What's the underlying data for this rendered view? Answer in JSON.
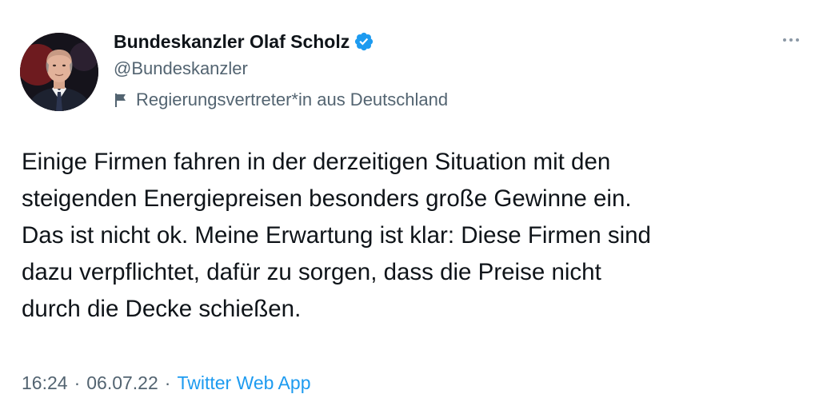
{
  "author": {
    "display_name": "Bundeskanzler Olaf Scholz",
    "handle": "@Bundeskanzler",
    "label": "Regierungsvertreter*in aus Deutschland",
    "verified": true,
    "avatar_icon": "avatar-photo"
  },
  "tweet": {
    "lines": [
      "Einige Firmen fahren in der derzeitigen Situation mit den",
      "steigenden Energiepreisen besonders große Gewinne ein.",
      "Das ist nicht ok. Meine Erwartung ist klar: Diese Firmen sind",
      "dazu verpflichtet, dafür zu sorgen, dass die Preise nicht",
      "durch die Decke schießen."
    ]
  },
  "meta": {
    "time": "16:24",
    "separator_1": "·",
    "date": "06.07.22",
    "separator_2": "·",
    "source": "Twitter Web App"
  },
  "icons": {
    "verified": "verified-badge-icon",
    "flag": "flag-icon",
    "more": "more-options-icon"
  },
  "colors": {
    "accent": "#1d9bf0",
    "text_primary": "#0f1419",
    "text_secondary": "#536471"
  }
}
